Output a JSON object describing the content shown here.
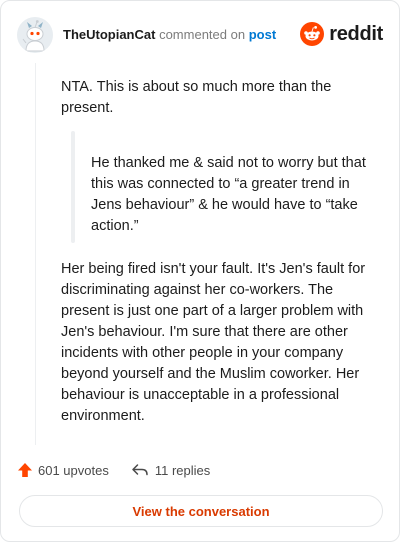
{
  "header": {
    "username": "TheUtopianCat",
    "action": "commented on",
    "post_link": "post",
    "brand": "reddit",
    "brand_color": "#ff4500",
    "avatar_icon": "snoo-avatar-icon"
  },
  "comment": {
    "paragraph1": "NTA. This is about so much more than the present.",
    "quote": "He thanked me & said not to worry but that this was connected to “a greater trend in Jens behaviour” & he would have to “take action.”",
    "paragraph2": "Her being fired isn't your fault. It's Jen's fault for discriminating against her co-workers. The present is just one part of a larger problem with Jen's behaviour. I'm sure that there are other incidents with other people in your company beyond yourself and the Muslim coworker. Her behaviour is unacceptable in a professional environment."
  },
  "stats": {
    "upvotes": "601 upvotes",
    "replies": "11 replies",
    "upvote_icon": "upvote-arrow-icon",
    "reply_icon": "reply-arrow-icon",
    "upvote_color": "#ff4500"
  },
  "cta": {
    "label": "View the conversation",
    "color": "#d93a00"
  }
}
